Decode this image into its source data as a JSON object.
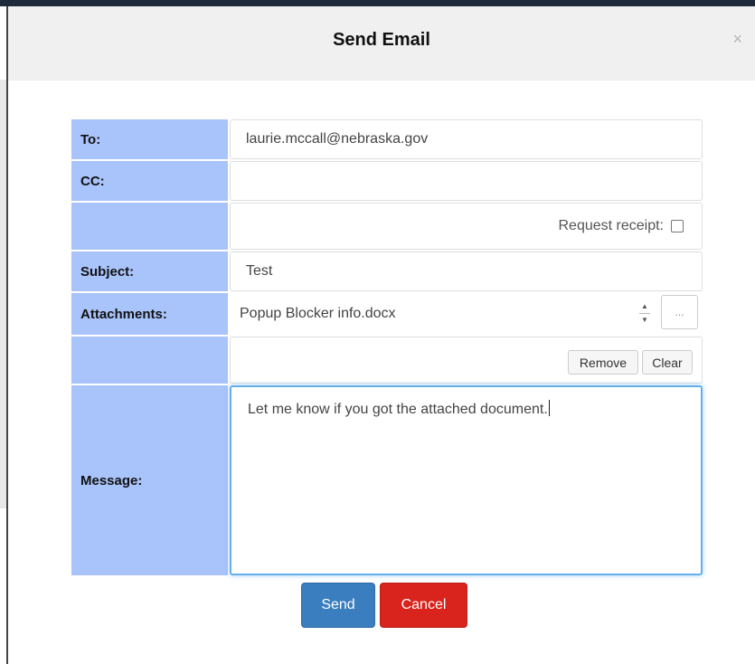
{
  "dialog": {
    "title": "Send Email",
    "close_glyph": "×"
  },
  "form": {
    "to": {
      "label": "To:",
      "value": "laurie.mccall@nebraska.gov"
    },
    "cc": {
      "label": "CC:",
      "value": ""
    },
    "receipt": {
      "label": "Request receipt:",
      "checked": false
    },
    "subject": {
      "label": "Subject:",
      "value": "Test"
    },
    "attachments": {
      "label": "Attachments:",
      "selected": "Popup Blocker info.docx",
      "browse_label": "...",
      "remove_label": "Remove",
      "clear_label": "Clear"
    },
    "message": {
      "label": "Message:",
      "value": "Let me know if you got the attached document."
    }
  },
  "actions": {
    "send_label": "Send",
    "cancel_label": "Cancel"
  },
  "colors": {
    "label_bg": "#a9c3fb",
    "send": "#3a7ebf",
    "cancel": "#d9231d",
    "focus": "#66afe9"
  },
  "icons": {
    "close": "close-icon",
    "spinner_up": "chevron-up-icon",
    "spinner_down": "chevron-down-icon"
  }
}
